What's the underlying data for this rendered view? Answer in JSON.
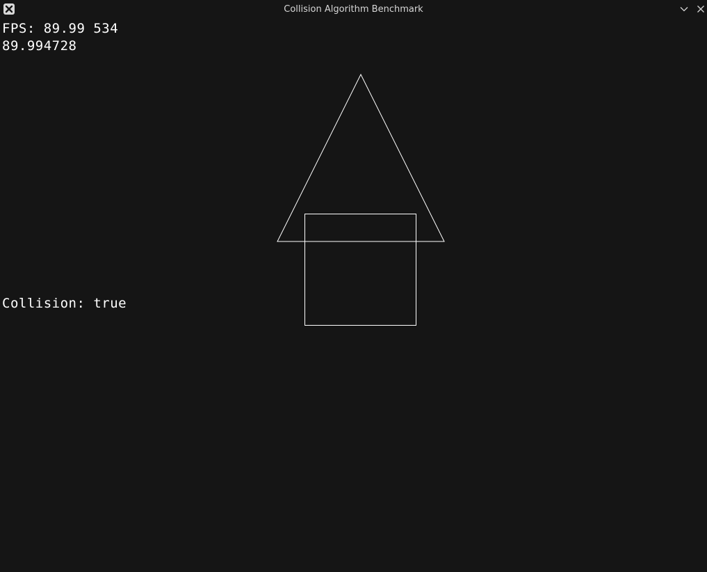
{
  "window": {
    "title": "Collision Algorithm Benchmark",
    "icons": {
      "app": "close-x-badge-icon",
      "minimize": "chevron-down-icon",
      "close": "close-icon"
    }
  },
  "hud": {
    "fps_label": "FPS: 89.99 534",
    "frame_value": "89.994728",
    "collision_label": "Collision: true"
  },
  "scene": {
    "shapes": [
      "triangle",
      "square"
    ],
    "stroke_color": "#ffffff",
    "background": "#151515"
  }
}
